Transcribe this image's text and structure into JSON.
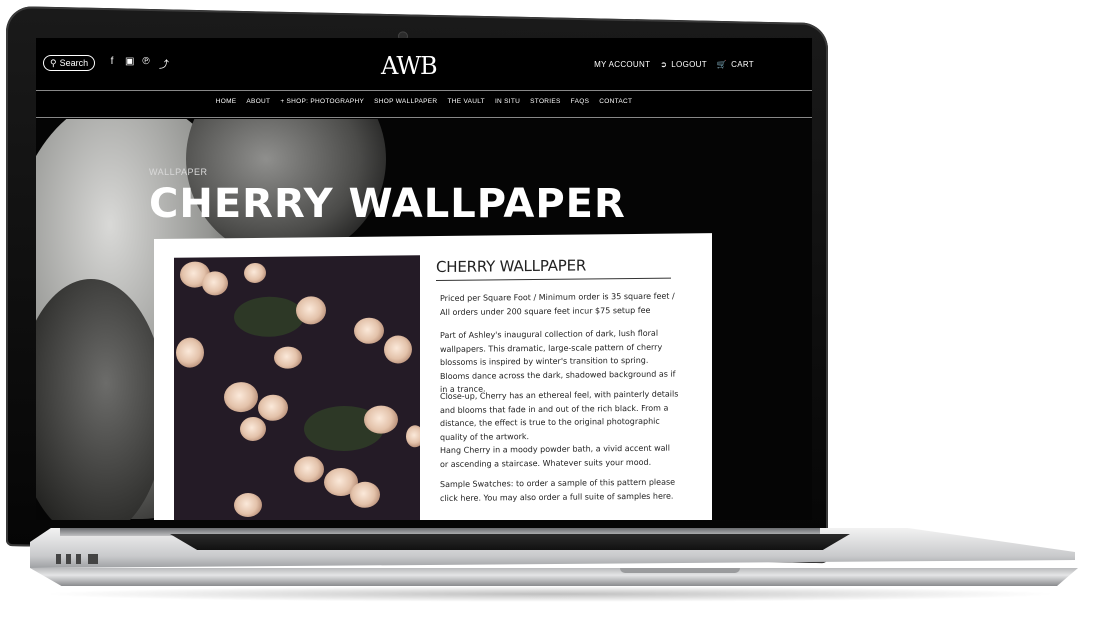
{
  "site": {
    "search_label": "Search",
    "logo": "AWB",
    "account": {
      "my_account": "MY ACCOUNT",
      "logout": "LOGOUT",
      "cart": "CART"
    },
    "social_icons": [
      "facebook-icon",
      "instagram-icon",
      "pinterest-icon",
      "twitter-icon"
    ],
    "nav": [
      "HOME",
      "ABOUT",
      "+ SHOP: PHOTOGRAPHY",
      "SHOP WALLPAPER",
      "THE VAULT",
      "IN SITU",
      "STORIES",
      "FAQS",
      "CONTACT"
    ]
  },
  "hero": {
    "eyebrow": "WALLPAPER",
    "title": "CHERRY WALLPAPER"
  },
  "product": {
    "title": "CHERRY WALLPAPER",
    "price_note": "Priced per Square Foot / Minimum order is 35 square feet / All orders under 200 square feet incur $75 setup fee",
    "paragraphs": [
      "Part of Ashley's inaugural collection of dark, lush floral wallpapers. This dramatic, large-scale pattern of cherry blossoms is inspired by winter's transition to spring. Blooms dance across the dark, shadowed background as if in a trance.",
      "Close-up, Cherry has an ethereal feel, with painterly details and blooms that fade in and out of the rich black. From a distance, the effect is true to the original photographic quality of the artwork.",
      "Hang Cherry in a moody powder bath, a vivid accent wall or ascending a staircase. Whatever suits your mood.",
      "Sample Swatches: to order a sample of this pattern please click here. You may also order a full suite of samples here."
    ]
  },
  "colors": {
    "site_background": "#000000",
    "card_background": "#ffffff",
    "blossom": "#f3dcc8"
  }
}
